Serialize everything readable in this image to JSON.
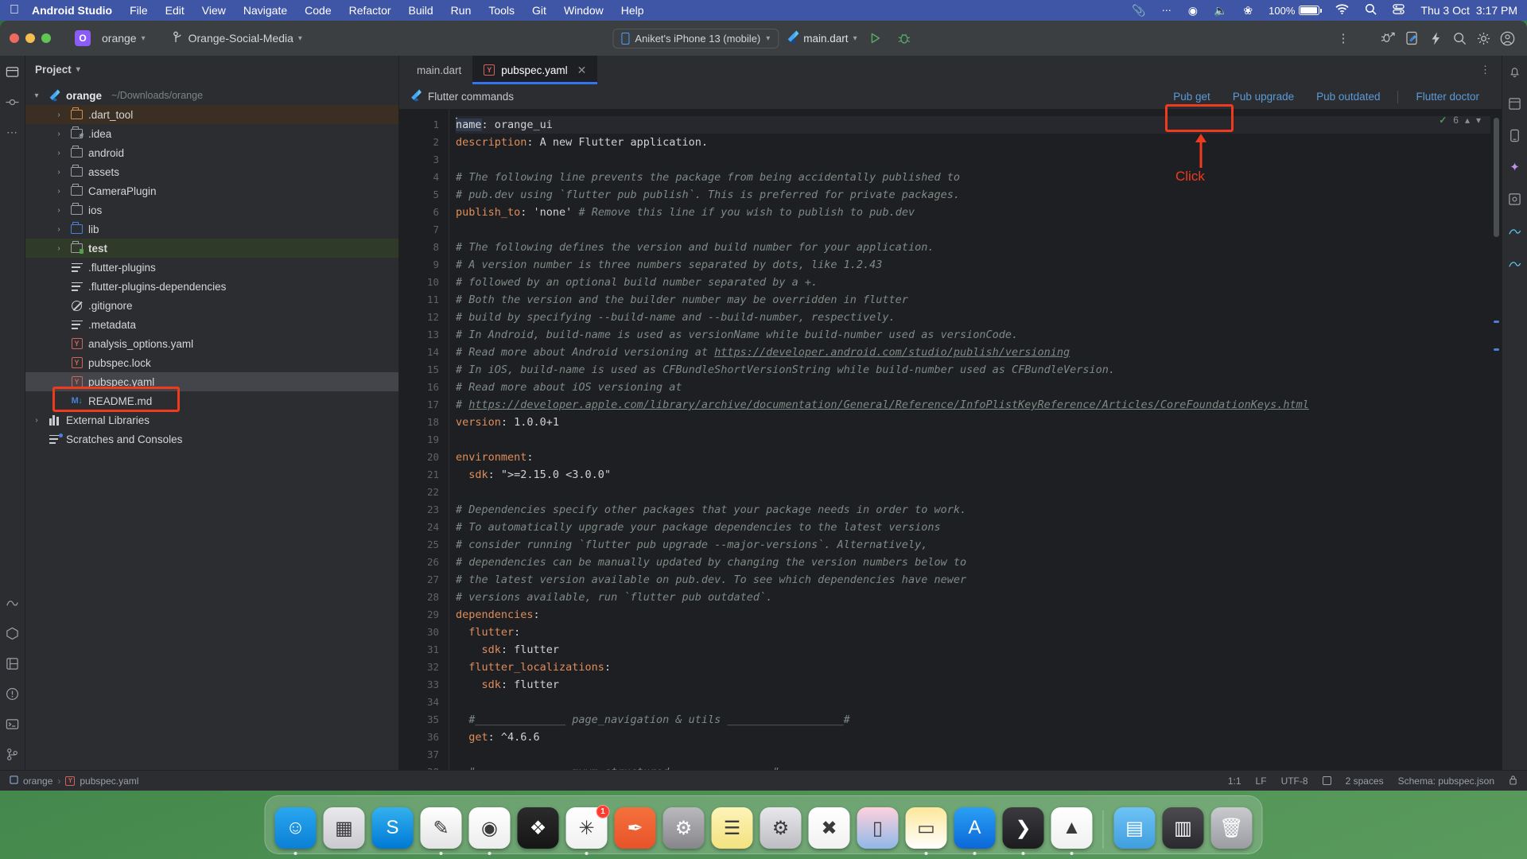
{
  "menubar": {
    "apple_icon": "apple-logo",
    "app_name": "Android Studio",
    "items": [
      "File",
      "Edit",
      "View",
      "Navigate",
      "Code",
      "Refactor",
      "Build",
      "Run",
      "Tools",
      "Git",
      "Window",
      "Help"
    ],
    "status": {
      "clipboard_icon": "paperclip-icon",
      "control_icon": "control-center-icon",
      "user_icon": "user-account-icon",
      "volume_icon": "volume-icon",
      "bluetooth_icon": "bluetooth-icon",
      "battery_percent": "100%",
      "wifi_icon": "wifi-icon",
      "search_icon": "spotlight-search-icon",
      "day": "Thu 3 Oct",
      "time": "3:17 PM"
    }
  },
  "titlebar": {
    "project_badge": "O",
    "project_name": "orange",
    "branch_name": "Orange-Social-Media",
    "device": "Aniket's iPhone 13 (mobile)",
    "run_config": "main.dart",
    "run_icon": "run-play-icon",
    "debug_icon": "debug-bug-icon",
    "more_icon": "more-vertical-icon",
    "attach_debug_icon": "attach-debugger-icon",
    "flutter_device_icon": "flutter-device-icon",
    "hot_reload_icon": "hot-reload-lightning-icon",
    "search_icon": "search-icon",
    "settings_icon": "gear-icon",
    "account_icon": "account-avatar-icon"
  },
  "project_panel": {
    "title": "Project",
    "tree": [
      {
        "label": "orange",
        "sub": "~/Downloads/orange",
        "icon": "flutter-icon",
        "indent": 0,
        "arrow": "down",
        "state": "root"
      },
      {
        "label": ".dart_tool",
        "icon": "folder-orange",
        "indent": 1,
        "arrow": "right",
        "state": "brown"
      },
      {
        "label": ".idea",
        "icon": "folder-module",
        "indent": 1,
        "arrow": "right",
        "state": ""
      },
      {
        "label": "android",
        "icon": "folder",
        "indent": 1,
        "arrow": "right",
        "state": ""
      },
      {
        "label": "assets",
        "icon": "folder",
        "indent": 1,
        "arrow": "right",
        "state": ""
      },
      {
        "label": "CameraPlugin",
        "icon": "folder",
        "indent": 1,
        "arrow": "right",
        "state": ""
      },
      {
        "label": "ios",
        "icon": "folder",
        "indent": 1,
        "arrow": "right",
        "state": ""
      },
      {
        "label": "lib",
        "icon": "folder-blue",
        "indent": 1,
        "arrow": "right",
        "state": ""
      },
      {
        "label": "test",
        "icon": "folder-test",
        "indent": 1,
        "arrow": "right",
        "state": "green"
      },
      {
        "label": ".flutter-plugins",
        "icon": "text-file",
        "indent": 1,
        "arrow": "",
        "state": ""
      },
      {
        "label": ".flutter-plugins-dependencies",
        "icon": "text-file",
        "indent": 1,
        "arrow": "",
        "state": ""
      },
      {
        "label": ".gitignore",
        "icon": "gitignore-file",
        "indent": 1,
        "arrow": "",
        "state": ""
      },
      {
        "label": ".metadata",
        "icon": "text-file",
        "indent": 1,
        "arrow": "",
        "state": ""
      },
      {
        "label": "analysis_options.yaml",
        "icon": "yaml-file",
        "indent": 1,
        "arrow": "",
        "state": ""
      },
      {
        "label": "pubspec.lock",
        "icon": "yaml-file",
        "indent": 1,
        "arrow": "",
        "state": ""
      },
      {
        "label": "pubspec.yaml",
        "icon": "yaml-file",
        "indent": 1,
        "arrow": "",
        "state": "selected"
      },
      {
        "label": "README.md",
        "icon": "markdown-file",
        "indent": 1,
        "arrow": "",
        "state": ""
      },
      {
        "label": "External Libraries",
        "icon": "library-icon",
        "indent": 0,
        "arrow": "right",
        "state": ""
      },
      {
        "label": "Scratches and Consoles",
        "icon": "scratches-icon",
        "indent": 0,
        "arrow": "",
        "state": ""
      }
    ]
  },
  "tabs": [
    {
      "label": "main.dart",
      "icon": "dart-file-icon",
      "active": false,
      "closable": false
    },
    {
      "label": "pubspec.yaml",
      "icon": "yaml-file-icon",
      "active": true,
      "closable": true
    }
  ],
  "notification_bar": {
    "icon": "flutter-icon",
    "label": "Flutter commands",
    "links": [
      "Pub get",
      "Pub upgrade",
      "Pub outdated",
      "Flutter doctor"
    ]
  },
  "editor": {
    "inspections": {
      "count": "6",
      "ok_icon": "checkmark-icon",
      "up_icon": "chevron-up-icon",
      "down_icon": "chevron-down-icon"
    },
    "lines": [
      {
        "n": 1,
        "segments": [
          {
            "t": "name",
            "c": "cursorword"
          },
          {
            "t": ": ",
            "c": "s"
          },
          {
            "t": "orange_ui",
            "c": "s"
          }
        ]
      },
      {
        "n": 2,
        "segments": [
          {
            "t": "description",
            "c": "k"
          },
          {
            "t": ": A new Flutter application.",
            "c": "s"
          }
        ]
      },
      {
        "n": 3,
        "segments": []
      },
      {
        "n": 4,
        "segments": [
          {
            "t": "# The following line prevents the package from being accidentally published to",
            "c": "c"
          }
        ]
      },
      {
        "n": 5,
        "segments": [
          {
            "t": "# pub.dev using `flutter pub publish`. This is preferred for private packages.",
            "c": "c"
          }
        ]
      },
      {
        "n": 6,
        "segments": [
          {
            "t": "publish_to",
            "c": "k"
          },
          {
            "t": ": 'none' ",
            "c": "s"
          },
          {
            "t": "# Remove this line if you wish to publish to pub.dev",
            "c": "c"
          }
        ]
      },
      {
        "n": 7,
        "segments": []
      },
      {
        "n": 8,
        "segments": [
          {
            "t": "# The following defines the version and build number for your application.",
            "c": "c"
          }
        ]
      },
      {
        "n": 9,
        "segments": [
          {
            "t": "# A version number is three numbers separated by dots, like 1.2.43",
            "c": "c"
          }
        ]
      },
      {
        "n": 10,
        "segments": [
          {
            "t": "# followed by an optional build number separated by a +.",
            "c": "c"
          }
        ]
      },
      {
        "n": 11,
        "segments": [
          {
            "t": "# Both the version and the builder number may be overridden in flutter",
            "c": "c"
          }
        ]
      },
      {
        "n": 12,
        "segments": [
          {
            "t": "# build by specifying --build-name and --build-number, respectively.",
            "c": "c"
          }
        ]
      },
      {
        "n": 13,
        "segments": [
          {
            "t": "# In Android, build-name is used as versionName while build-number used as versionCode.",
            "c": "c"
          }
        ]
      },
      {
        "n": 14,
        "segments": [
          {
            "t": "# Read more about Android versioning at ",
            "c": "c"
          },
          {
            "t": "https://developer.android.com/studio/publish/versioning",
            "c": "u"
          }
        ]
      },
      {
        "n": 15,
        "segments": [
          {
            "t": "# In iOS, build-name is used as CFBundleShortVersionString while build-number used as CFBundleVersion.",
            "c": "c"
          }
        ]
      },
      {
        "n": 16,
        "segments": [
          {
            "t": "# Read more about iOS versioning at",
            "c": "c"
          }
        ]
      },
      {
        "n": 17,
        "segments": [
          {
            "t": "# ",
            "c": "c"
          },
          {
            "t": "https://developer.apple.com/library/archive/documentation/General/Reference/InfoPlistKeyReference/Articles/CoreFoundationKeys.html",
            "c": "u"
          }
        ]
      },
      {
        "n": 18,
        "segments": [
          {
            "t": "version",
            "c": "k"
          },
          {
            "t": ": 1.0.0+1",
            "c": "s"
          }
        ]
      },
      {
        "n": 19,
        "segments": []
      },
      {
        "n": 20,
        "segments": [
          {
            "t": "environment",
            "c": "k"
          },
          {
            "t": ":",
            "c": "s"
          }
        ]
      },
      {
        "n": 21,
        "segments": [
          {
            "t": "  sdk",
            "c": "k"
          },
          {
            "t": ": \">=2.15.0 <3.0.0\"",
            "c": "s"
          }
        ]
      },
      {
        "n": 22,
        "segments": []
      },
      {
        "n": 23,
        "segments": [
          {
            "t": "# Dependencies specify other packages that your package needs in order to work.",
            "c": "c"
          }
        ]
      },
      {
        "n": 24,
        "segments": [
          {
            "t": "# To automatically upgrade your package dependencies to the latest versions",
            "c": "c"
          }
        ]
      },
      {
        "n": 25,
        "segments": [
          {
            "t": "# consider running `flutter pub upgrade --major-versions`. Alternatively,",
            "c": "c"
          }
        ]
      },
      {
        "n": 26,
        "segments": [
          {
            "t": "# dependencies can be manually updated by changing the version numbers below to",
            "c": "c"
          }
        ]
      },
      {
        "n": 27,
        "segments": [
          {
            "t": "# the latest version available on pub.dev. To see which dependencies have newer",
            "c": "c"
          }
        ]
      },
      {
        "n": 28,
        "segments": [
          {
            "t": "# versions available, run `flutter pub outdated`.",
            "c": "c"
          }
        ]
      },
      {
        "n": 29,
        "segments": [
          {
            "t": "dependencies",
            "c": "k"
          },
          {
            "t": ":",
            "c": "s"
          }
        ]
      },
      {
        "n": 30,
        "segments": [
          {
            "t": "  flutter",
            "c": "k"
          },
          {
            "t": ":",
            "c": "s"
          }
        ]
      },
      {
        "n": 31,
        "segments": [
          {
            "t": "    sdk",
            "c": "k"
          },
          {
            "t": ": flutter",
            "c": "s"
          }
        ]
      },
      {
        "n": 32,
        "segments": [
          {
            "t": "  flutter_localizations",
            "c": "k"
          },
          {
            "t": ":",
            "c": "s"
          }
        ]
      },
      {
        "n": 33,
        "segments": [
          {
            "t": "    sdk",
            "c": "k"
          },
          {
            "t": ": flutter",
            "c": "s"
          }
        ]
      },
      {
        "n": 34,
        "segments": []
      },
      {
        "n": 35,
        "segments": [
          {
            "t": "  #______________ page_navigation & utils __________________#",
            "c": "c"
          }
        ]
      },
      {
        "n": 36,
        "segments": [
          {
            "t": "  get",
            "c": "k"
          },
          {
            "t": ": ^4.6.6",
            "c": "s"
          }
        ]
      },
      {
        "n": 37,
        "segments": []
      },
      {
        "n": 38,
        "segments": [
          {
            "t": "  #______________ mvvm structured _______________#",
            "c": "c"
          }
        ]
      }
    ]
  },
  "annotations": {
    "click_label": "Click",
    "color": "#f03a1e"
  },
  "statusbar": {
    "breadcrumb_project": "orange",
    "breadcrumb_file": "pubspec.yaml",
    "position": "1:1",
    "line_sep": "LF",
    "encoding": "UTF-8",
    "indent": "2 spaces",
    "schema": "Schema: pubspec.json",
    "lock_icon": "lock-icon"
  },
  "dock": {
    "apps": [
      {
        "name": "finder",
        "bg": "linear-gradient(180deg,#2aa7f0,#0b7fd4)",
        "glyph": "☺",
        "running": true
      },
      {
        "name": "launchpad",
        "bg": "linear-gradient(180deg,#e9e9ed,#c9c9cf)",
        "glyph": "▦",
        "running": false
      },
      {
        "name": "skype",
        "bg": "linear-gradient(180deg,#33b1ef,#0078d4)",
        "glyph": "S",
        "running": false
      },
      {
        "name": "notes-pen",
        "bg": "linear-gradient(180deg,#ffffff,#e4e4e6)",
        "glyph": "✎",
        "running": true
      },
      {
        "name": "chrome",
        "bg": "linear-gradient(180deg,#ffffff,#ededed)",
        "glyph": "◉",
        "running": true
      },
      {
        "name": "figma",
        "bg": "linear-gradient(180deg,#2b2b2b,#151515)",
        "glyph": "❖",
        "running": false
      },
      {
        "name": "slack",
        "bg": "linear-gradient(180deg,#ffffff,#f0f0f0)",
        "glyph": "✳",
        "running": true,
        "badge": "1"
      },
      {
        "name": "postman",
        "bg": "linear-gradient(180deg,#f4713b,#e8532a)",
        "glyph": "✒",
        "running": false
      },
      {
        "name": "settings-gear",
        "bg": "linear-gradient(180deg,#b9b9bd,#86868b)",
        "glyph": "⚙",
        "running": false
      },
      {
        "name": "notes",
        "bg": "linear-gradient(180deg,#fdf3b8,#f3e27f)",
        "glyph": "☰",
        "running": false
      },
      {
        "name": "system-preferences",
        "bg": "linear-gradient(180deg,#e8e8ec,#bcbcc2)",
        "glyph": "⚙",
        "running": false
      },
      {
        "name": "vscode",
        "bg": "linear-gradient(180deg,#ffffff,#f2f2f2)",
        "glyph": "✖",
        "running": false
      },
      {
        "name": "iphone-mirroring",
        "bg": "linear-gradient(180deg,#ffd1dc,#8fb8e8)",
        "glyph": "▯",
        "running": false
      },
      {
        "name": "stickies",
        "bg": "linear-gradient(180deg,#fde79a,#ffffff)",
        "glyph": "▭",
        "running": true
      },
      {
        "name": "app-store",
        "bg": "linear-gradient(180deg,#2aa0f5,#0b67d8)",
        "glyph": "A",
        "running": true
      },
      {
        "name": "terminal",
        "bg": "linear-gradient(180deg,#3b3b40,#1c1c1f)",
        "glyph": "❯",
        "running": true
      },
      {
        "name": "android-studio",
        "bg": "linear-gradient(180deg,#ffffff,#f0f0f0)",
        "glyph": "▲",
        "running": true
      }
    ],
    "extras": [
      {
        "name": "downloads-folder",
        "bg": "linear-gradient(180deg,#6ec3f5,#3f9ede)",
        "glyph": "▤"
      },
      {
        "name": "recent-item",
        "bg": "linear-gradient(180deg,#4b4b50,#2a2a2e)",
        "glyph": "▥"
      },
      {
        "name": "trash",
        "bg": "linear-gradient(180deg,#c8cace,#9a9ca1)",
        "glyph": "🗑"
      }
    ]
  }
}
